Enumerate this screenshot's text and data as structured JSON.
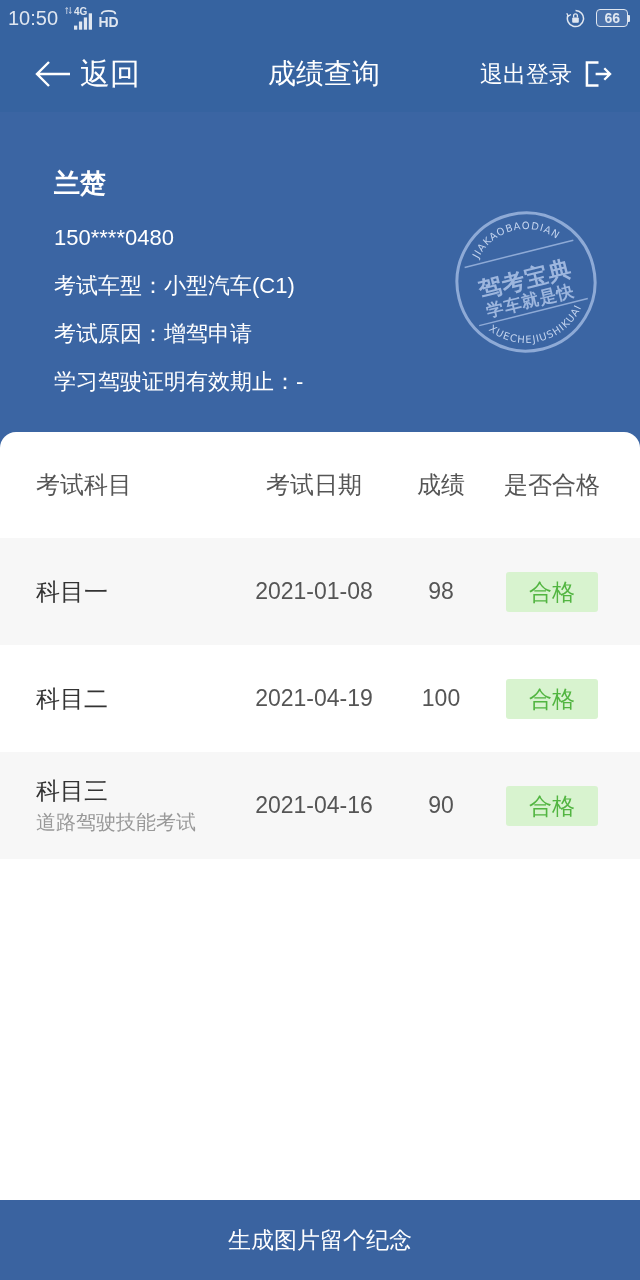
{
  "status_bar": {
    "time": "10:50",
    "network": "4G",
    "hd": "HD",
    "battery": "66"
  },
  "nav": {
    "back": "返回",
    "title": "成绩查询",
    "logout": "退出登录"
  },
  "profile": {
    "name": "兰楚",
    "phone": "150****0480",
    "lines": [
      "考试车型：小型汽车(C1)",
      "考试原因：增驾申请",
      "学习驾驶证明有效期止：-"
    ],
    "seal": {
      "arc_top": "JIAKAOBAODIAN",
      "title": "驾考宝典",
      "slogan": "学车就是快",
      "arc_bottom": "XUECHEJIUSHIKUAI"
    }
  },
  "table": {
    "columns": [
      "考试科目",
      "考试日期",
      "成绩",
      "是否合格"
    ],
    "rows": [
      {
        "subject": "科目一",
        "date": "2021-01-08",
        "score": "98",
        "result": "合格"
      },
      {
        "subject": "科目二",
        "date": "2021-04-19",
        "score": "100",
        "result": "合格"
      },
      {
        "subject": "科目三",
        "note": "道路驾驶技能考试",
        "date": "2021-04-16",
        "score": "90",
        "result": "合格"
      }
    ]
  },
  "footer_button": "生成图片留个纪念"
}
